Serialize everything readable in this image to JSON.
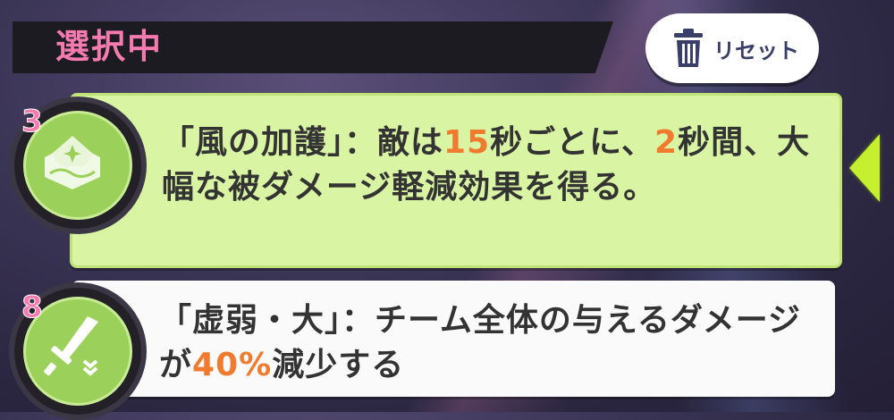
{
  "header": {
    "title": "選択中"
  },
  "reset_button": {
    "label": "リセット",
    "icon": "trash-icon"
  },
  "effects": [
    {
      "level": "3",
      "icon": "wind-protection-icon",
      "text_parts": [
        "「風の加護」：敵は",
        "15",
        "秒ごとに、",
        "2",
        "秒間、大幅な被ダメージ軽減効果を得る。"
      ]
    },
    {
      "level": "8",
      "icon": "weakened-sword-icon",
      "text_parts": [
        "「虚弱・大」：チーム全体の与えるダメージが",
        "40%",
        "減少する"
      ]
    }
  ],
  "colors": {
    "highlight": "#f07a2e",
    "title": "#f47ab0",
    "selected_card": "#d9f5a3"
  }
}
